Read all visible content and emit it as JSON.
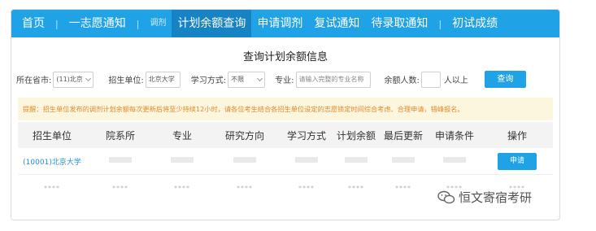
{
  "nav": {
    "home": "首页",
    "first_choice": "一志愿通知",
    "transfer": "调剂",
    "plan_query": "计划余额查询",
    "apply_transfer": "申请调剂",
    "retest": "复试通知",
    "pending": "待录取通知",
    "scores": "初试成绩",
    "sep": "|"
  },
  "page_title": "查询计划余额信息",
  "filters": {
    "province_label": "所在省市:",
    "province_value": "(11)北京",
    "school_label": "招生单位:",
    "school_value": "北京大学",
    "mode_label": "学习方式:",
    "mode_value": "不限",
    "major_label": "专业:",
    "major_placeholder": "请输入完整的专业名称",
    "remain_label": "余额人数:",
    "remain_suffix": "人以上",
    "query_button": "查询"
  },
  "notice": "提醒：招生单位发布的调剂计划余额每次更新后将至少持续12小时，请各位考生结合各招生单位设定的志愿锁定时间综合考虑、合理申请，错峰报名。",
  "table": {
    "headers": [
      "招生单位",
      "院系所",
      "专业",
      "研究方向",
      "学习方式",
      "计划余额",
      "最后更新",
      "申请条件",
      "操作"
    ],
    "row1": {
      "school": "(10001)北京大学",
      "action": "申请"
    },
    "row2_mask": "****"
  },
  "watermark": "恒文寄宿考研",
  "colors": {
    "accent": "#1fa3e6",
    "notice_bg": "#fdf6df",
    "notice_text": "#e08a2a",
    "link": "#1f8ee0"
  }
}
